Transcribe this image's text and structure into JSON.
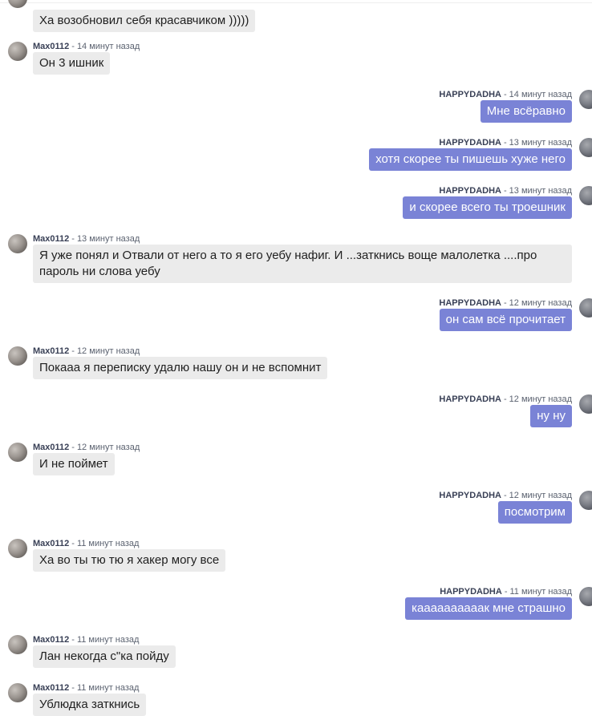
{
  "messages": [
    {
      "side": "left",
      "user": "",
      "time": "",
      "text": "Ха возобновил себя красавчиком )))))"
    },
    {
      "side": "left",
      "user": "Max0112",
      "time": "14 минут назад",
      "text": "Он 3 ишник"
    },
    {
      "side": "right",
      "user": "HAPPYDADHA",
      "time": "14 минут назад",
      "text": "Мне всёравно"
    },
    {
      "side": "right",
      "user": "HAPPYDADHA",
      "time": "13 минут назад",
      "text": "хотя скорее ты пишешь хуже него"
    },
    {
      "side": "right",
      "user": "HAPPYDADHA",
      "time": "13 минут назад",
      "text": "и скорее всего ты троешник"
    },
    {
      "side": "left",
      "user": "Max0112",
      "time": "13 минут назад",
      "text": "Я уже понял и Отвали от него а то я его уебу нафиг. И ...заткнись воще малолетка ....про пароль ни слова уебу"
    },
    {
      "side": "right",
      "user": "HAPPYDADHA",
      "time": "12 минут назад",
      "text": "он сам всё прочитает"
    },
    {
      "side": "left",
      "user": "Max0112",
      "time": "12 минут назад",
      "text": "Покааа я переписку удалю нашу он и не вспомнит"
    },
    {
      "side": "right",
      "user": "HAPPYDADHA",
      "time": "12 минут назад",
      "text": "ну ну"
    },
    {
      "side": "left",
      "user": "Max0112",
      "time": "12 минут назад",
      "text": "И не поймет"
    },
    {
      "side": "right",
      "user": "HAPPYDADHA",
      "time": "12 минут назад",
      "text": "посмотрим"
    },
    {
      "side": "left",
      "user": "Max0112",
      "time": "11 минут назад",
      "text": "Ха во ты тю тю я хакер могу все"
    },
    {
      "side": "right",
      "user": "HAPPYDADHA",
      "time": "11 минут назад",
      "text": "каааааааааак мне страшно"
    },
    {
      "side": "left",
      "user": "Max0112",
      "time": "11 минут назад",
      "text": "Лан некогда с\"ка пойду"
    },
    {
      "side": "left",
      "user": "Max0112",
      "time": "11 минут назад",
      "text": "Ублюдка заткнись"
    }
  ]
}
